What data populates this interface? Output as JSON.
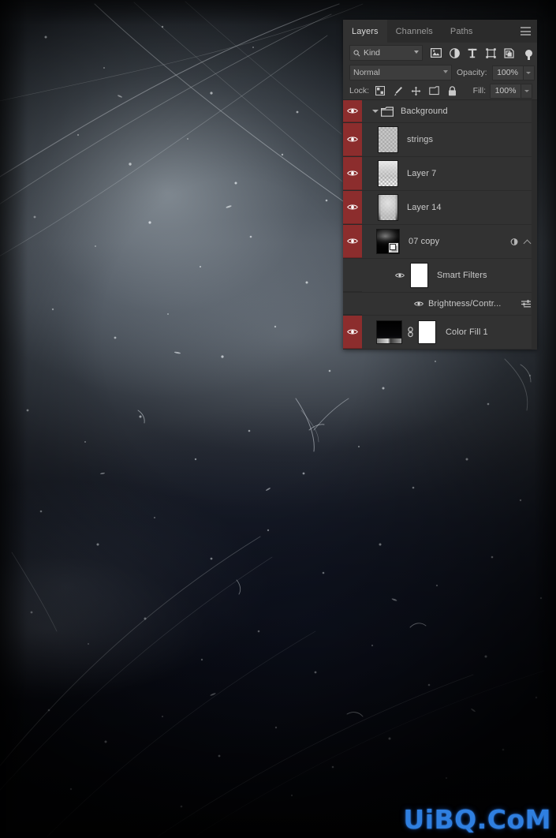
{
  "app": {
    "name": "Adobe Photoshop",
    "panel_title": "Layers"
  },
  "panel": {
    "tabs": [
      {
        "label": "Layers",
        "active": true
      },
      {
        "label": "Channels",
        "active": false
      },
      {
        "label": "Paths",
        "active": false
      }
    ],
    "menu_icon": "hamburger-menu-icon",
    "filter": {
      "kind_label": "Kind",
      "search_icon": "search-icon",
      "icons": [
        "filter-pixel-layers-icon",
        "filter-adjustment-layers-icon",
        "filter-type-layers-icon",
        "filter-shape-layers-icon",
        "filter-smart-object-layers-icon",
        "filter-toggle-icon"
      ]
    },
    "blend": {
      "mode": "Normal",
      "opacity_label": "Opacity:",
      "opacity_value": "100%"
    },
    "lock": {
      "label": "Lock:",
      "icons": [
        "lock-transparent-pixels-icon",
        "lock-image-pixels-icon",
        "lock-position-icon",
        "lock-artboard-nesting-icon",
        "lock-all-icon"
      ],
      "fill_label": "Fill:",
      "fill_value": "100%"
    },
    "layers": [
      {
        "name": "Background",
        "type": "group",
        "visible": true,
        "expanded": true,
        "eye_icon": "eye-visible-icon",
        "disclosure_icon": "chevron-down-icon",
        "folder_icon": "folder-icon"
      },
      {
        "name": "strings",
        "type": "pixel",
        "visible": true,
        "eye_icon": "eye-visible-icon",
        "thumbnail": "transparent-grey-noise-thumbnail"
      },
      {
        "name": "Layer 7",
        "type": "pixel",
        "visible": true,
        "eye_icon": "eye-visible-icon",
        "thumbnail": "transparent-grey-gradient-thumbnail"
      },
      {
        "name": "Layer 14",
        "type": "pixel",
        "visible": true,
        "eye_icon": "eye-visible-icon",
        "thumbnail": "transparent-grey-blob-thumbnail"
      },
      {
        "name": "07 copy",
        "type": "smart-object",
        "visible": true,
        "eye_icon": "eye-visible-icon",
        "thumbnail": "dark-photo-thumbnail",
        "badge_icon": "smart-object-badge-icon",
        "filter_indicator_icon": "smart-filter-indicator-icon",
        "collapse_icon": "chevron-up-icon"
      },
      {
        "name": "Smart Filters",
        "type": "smart-filter-group",
        "visible": true,
        "eye_icon": "eye-visible-icon",
        "thumbnail": "white-filter-mask-thumbnail"
      },
      {
        "name": "Brightness/Contr...",
        "type": "smart-filter",
        "visible": true,
        "eye_icon": "eye-visible-icon",
        "settings_icon": "filter-settings-sliders-icon"
      },
      {
        "name": "Color Fill 1",
        "type": "fill-layer",
        "visible": true,
        "eye_icon": "eye-visible-icon",
        "thumbnail": "dark-gradient-fill-thumbnail",
        "link_icon": "link-chain-icon",
        "mask_thumbnail": "white-layer-mask-thumbnail"
      }
    ]
  },
  "watermark": {
    "text": "UiBQ.CoM",
    "color": "#2f7fe0"
  },
  "colors": {
    "panel_bg": "#323232",
    "tab_bg": "#2b2b2b",
    "visibility_column": "#8c2d2d",
    "field_bg": "#3d3d3d",
    "text": "#c9c9c9"
  }
}
